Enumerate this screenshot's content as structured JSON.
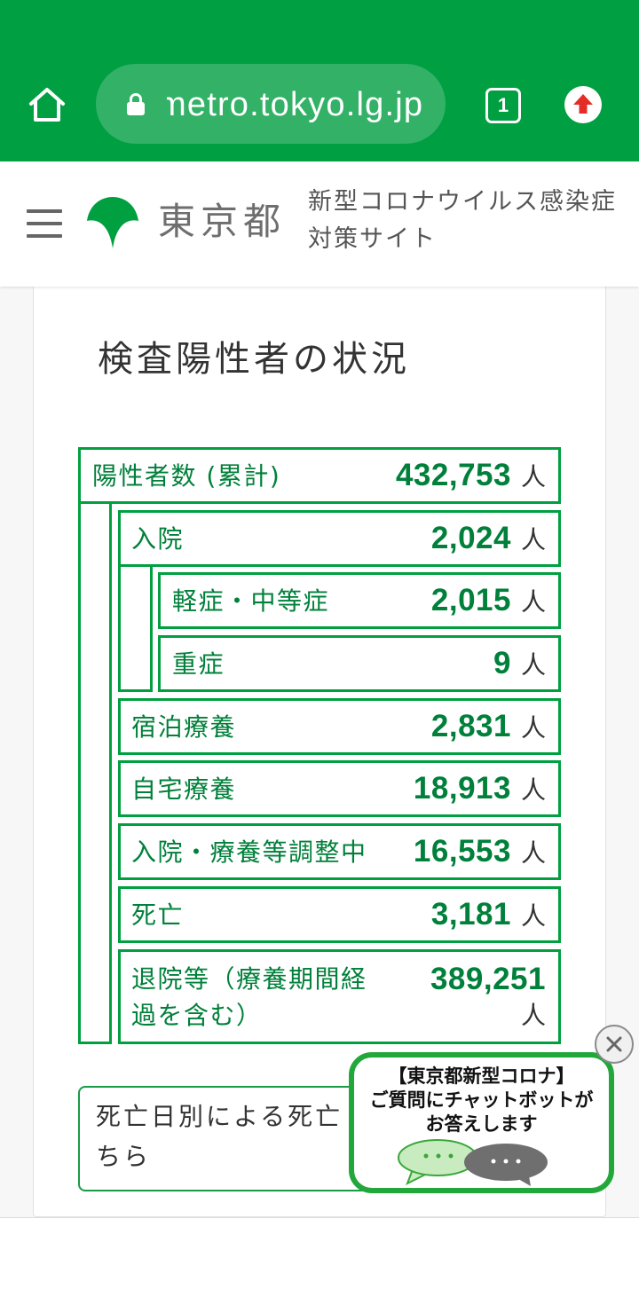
{
  "theme": {
    "brand_green": "#009f41",
    "stat_border_green": "#00a040",
    "value_green": "#00803a",
    "update_red": "#e52d27"
  },
  "browser": {
    "home_icon": "home-icon",
    "lock_icon": "lock-icon",
    "url": "metro.tokyo.lg.jp",
    "tab_count": "1",
    "tab_icon": "tab-switcher-icon",
    "update_icon": "upload-arrow-icon"
  },
  "site_header": {
    "menu_icon": "hamburger-menu-icon",
    "logo_icon": "tokyo-ginkgo-logo-icon",
    "org_name": "東京都",
    "site_title_line1": "新型コロナウイルス感染症",
    "site_title_line2": "対策サイト"
  },
  "card": {
    "title": "検査陽性者の状況",
    "total": {
      "label": "陽性者数 (累計)",
      "value": "432,753",
      "unit": "人"
    },
    "hospitalized": {
      "label": "入院",
      "value": "2,024",
      "unit": "人",
      "breakdown": [
        {
          "label": "軽症・中等症",
          "value": "2,015",
          "unit": "人"
        },
        {
          "label": "重症",
          "value": "9",
          "unit": "人"
        }
      ]
    },
    "categories": [
      {
        "label": "宿泊療養",
        "value": "2,831",
        "unit": "人"
      },
      {
        "label": "自宅療養",
        "value": "18,913",
        "unit": "人"
      },
      {
        "label": "入院・療養等調整中",
        "value": "16,553",
        "unit": "人"
      },
      {
        "label": "死亡",
        "value": "3,181",
        "unit": "人"
      },
      {
        "label": "退院等（療養期間経過を含む）",
        "value": "389,251",
        "unit": "人"
      }
    ]
  },
  "deaths_link": {
    "line1": "死亡日別による死亡",
    "line2": "ちら"
  },
  "chatbot": {
    "lines": [
      "【東京都新型コロナ】",
      "ご質問にチャットボットが",
      "お答えします"
    ],
    "bubble_icon": "chat-bubbles-icon",
    "close_icon": "close-icon"
  }
}
